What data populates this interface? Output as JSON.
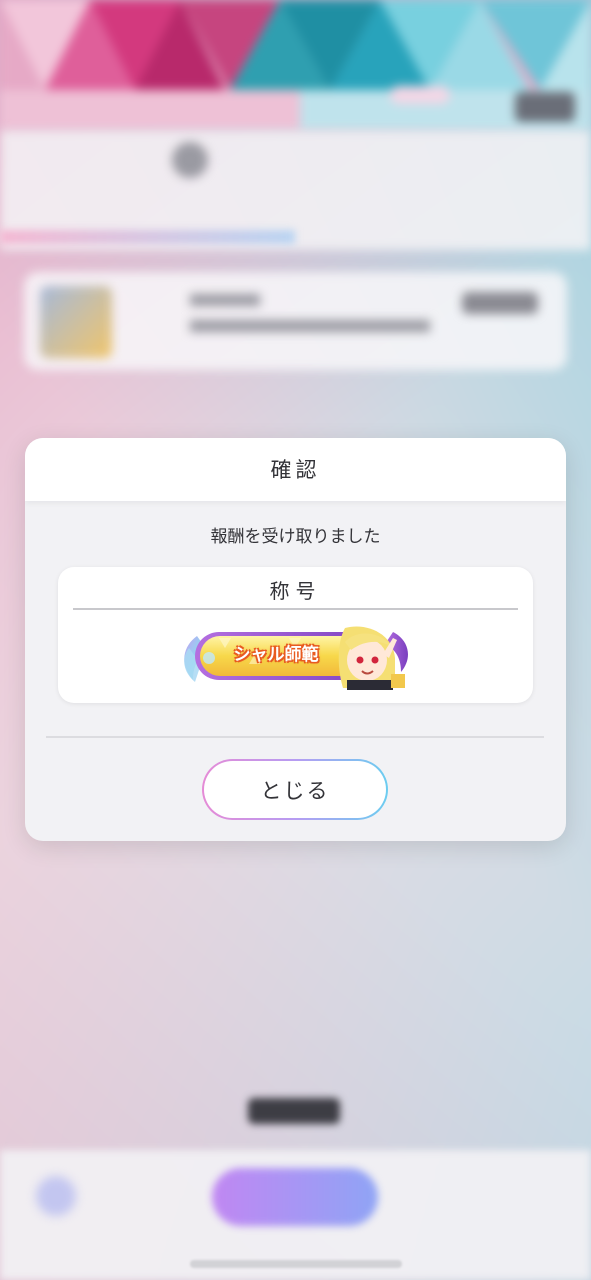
{
  "modal": {
    "title": "確認",
    "message": "報酬を受け取りました",
    "reward": {
      "label": "称号",
      "title_name": "シャル師範"
    },
    "close_label": "とじる"
  },
  "colors": {
    "accent_pink": "#e58bd6",
    "accent_blue": "#6ccdf0",
    "badge_yellow": "#f7d84a",
    "badge_orange": "#e85a20",
    "badge_purple": "#8c4fc9"
  },
  "icons": {
    "badge_wing": "wing-icon",
    "badge_character": "character-portrait"
  }
}
